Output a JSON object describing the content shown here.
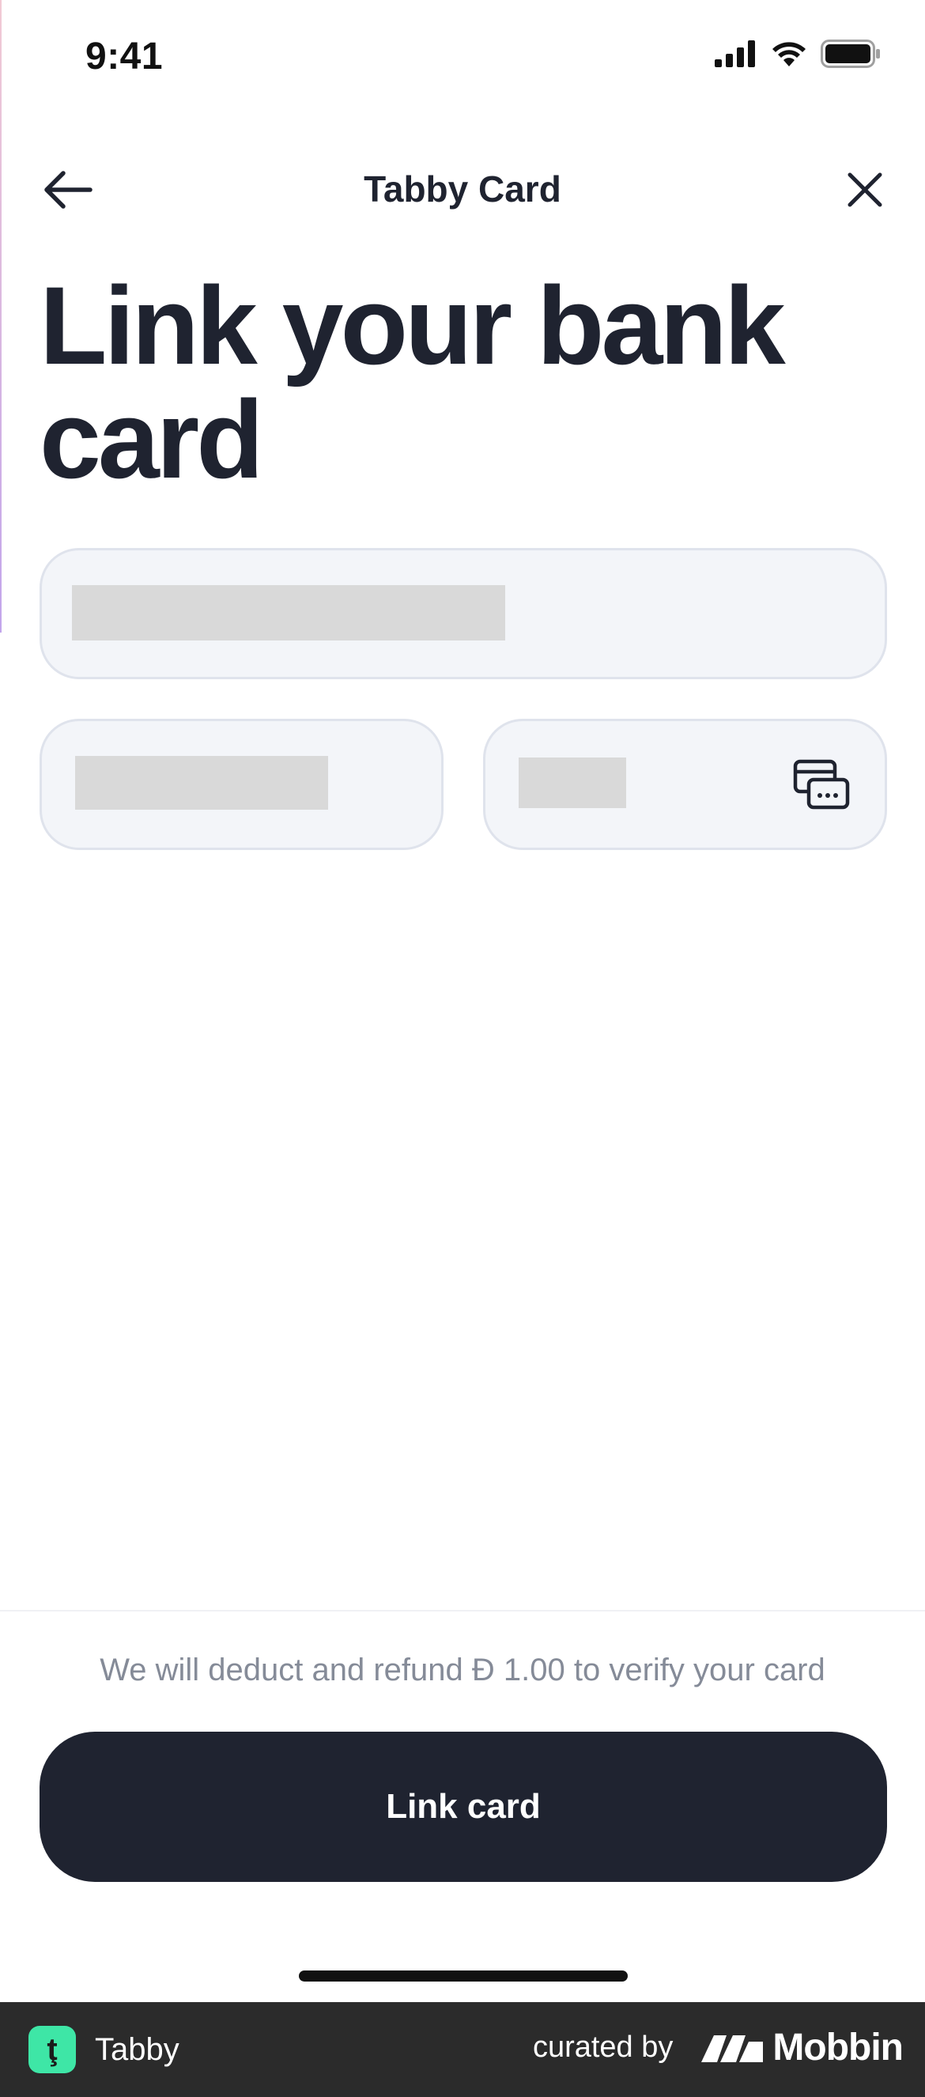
{
  "status_bar": {
    "time": "9:41"
  },
  "nav": {
    "title": "Tabby Card",
    "back_icon": "arrow-left-icon",
    "close_icon": "close-icon"
  },
  "page": {
    "title": "Link your bank card"
  },
  "form": {
    "card_number": {
      "value": ""
    },
    "expiry": {
      "value": ""
    },
    "cvv": {
      "value": "",
      "icon": "card-cvv-icon"
    }
  },
  "footer": {
    "note": "We will deduct and refund Đ 1.00 to verify your card",
    "button_label": "Link card"
  },
  "brand_bar": {
    "app_name": "Tabby",
    "app_logo_glyph": "ţ",
    "curated_by": "curated by",
    "mobbin": "Mobbin"
  },
  "colors": {
    "primary": "#1f2330",
    "field_bg": "#f3f5f9",
    "field_border": "#dfe3ec",
    "muted_text": "#858b98",
    "tabby_green": "#3ee6a6"
  }
}
